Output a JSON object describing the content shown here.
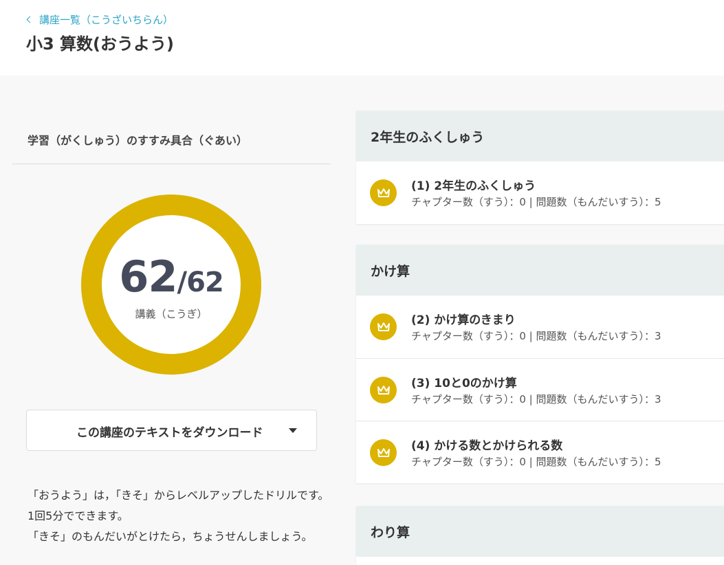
{
  "header": {
    "back_label": "講座一覧（こうざいちらん）",
    "title": "小3 算数(おうよう)"
  },
  "progress": {
    "heading": "学習（がくしゅう）のすすみ具合（ぐあい）",
    "completed": "62",
    "separator": "/",
    "total": "62",
    "unit_label": "講義（こうぎ）",
    "ring_color": "#dbb300"
  },
  "download": {
    "label": "この講座のテキストをダウンロード",
    "icon": "caret-down-icon"
  },
  "description": [
    "「おうよう」は，「きそ」からレベルアップしたドリルです。1回5分でできます。",
    "「きそ」のもんだいがとけたら，ちょうせんしましょう。"
  ],
  "units": [
    {
      "title": "2年生のふくしゅう",
      "lessons": [
        {
          "title": "(1) 2年生のふくしゅう",
          "meta": "チャプター数（すう）：0 | 問題数（もんだいすう）：5",
          "icon": "crown-icon"
        }
      ]
    },
    {
      "title": "かけ算",
      "lessons": [
        {
          "title": "(2) かけ算のきまり",
          "meta": "チャプター数（すう）：0 | 問題数（もんだいすう）：3",
          "icon": "crown-icon"
        },
        {
          "title": "(3) 10と0のかけ算",
          "meta": "チャプター数（すう）：0 | 問題数（もんだいすう）：3",
          "icon": "crown-icon"
        },
        {
          "title": "(4) かける数とかけられる数",
          "meta": "チャプター数（すう）：0 | 問題数（もんだいすう）：5",
          "icon": "crown-icon"
        }
      ]
    },
    {
      "title": "わり算",
      "lessons": []
    }
  ],
  "colors": {
    "accent_link": "#2ba5c8",
    "crown_badge": "#dbb300",
    "unit_header_bg": "#e9efee"
  }
}
